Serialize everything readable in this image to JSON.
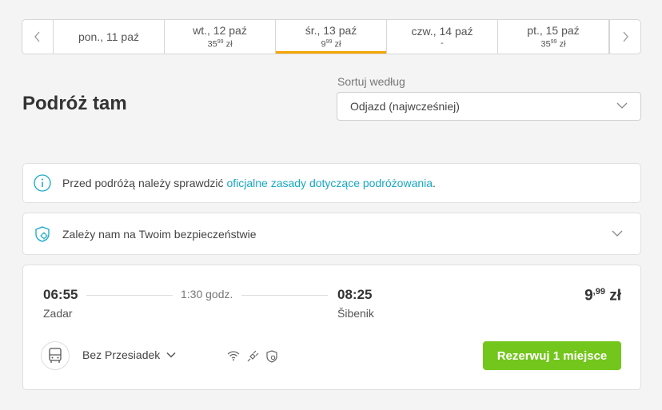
{
  "datebar": {
    "days": [
      {
        "label": "pon., 11 paź",
        "price_main": "",
        "price_cents": "",
        "price_currency": ""
      },
      {
        "label": "wt., 12 paź",
        "price_main": "35",
        "price_cents": "99",
        "price_currency": " zł"
      },
      {
        "label": "śr., 13 paź",
        "price_main": "9",
        "price_cents": "99",
        "price_currency": " zł"
      },
      {
        "label": "czw., 14 paź",
        "price_main": "-",
        "price_cents": "",
        "price_currency": ""
      },
      {
        "label": "pt., 15 paź",
        "price_main": "35",
        "price_cents": "99",
        "price_currency": " zł"
      }
    ],
    "active_index": 2,
    "accent": "#f5a500"
  },
  "page": {
    "title": "Podróż tam"
  },
  "sort": {
    "label": "Sortuj według",
    "value": "Odjazd (najwcześniej)"
  },
  "info": {
    "text_before": "Przed podróżą należy sprawdzić ",
    "link": "oficjalne zasady dotyczące podróżowania",
    "text_after": "."
  },
  "safety": {
    "text": "Zależy nam na Twoim bezpieczeństwie"
  },
  "trip": {
    "departure_time": "06:55",
    "departure_city": "Zadar",
    "duration": "1:30 godz.",
    "arrival_time": "08:25",
    "arrival_city": "Šibenik",
    "price_main": "9",
    "price_cents": ",99",
    "price_currency": " zł",
    "transfers": "Bez Przesiadek",
    "amenities": [
      "wifi-icon",
      "power-plug-icon",
      "safety-shield-icon"
    ],
    "book_label": "Rezerwuj 1 miejsce",
    "book_color": "#73c61c"
  },
  "colors": {
    "link": "#17a8c4",
    "info_icon": "#17a8c4"
  }
}
